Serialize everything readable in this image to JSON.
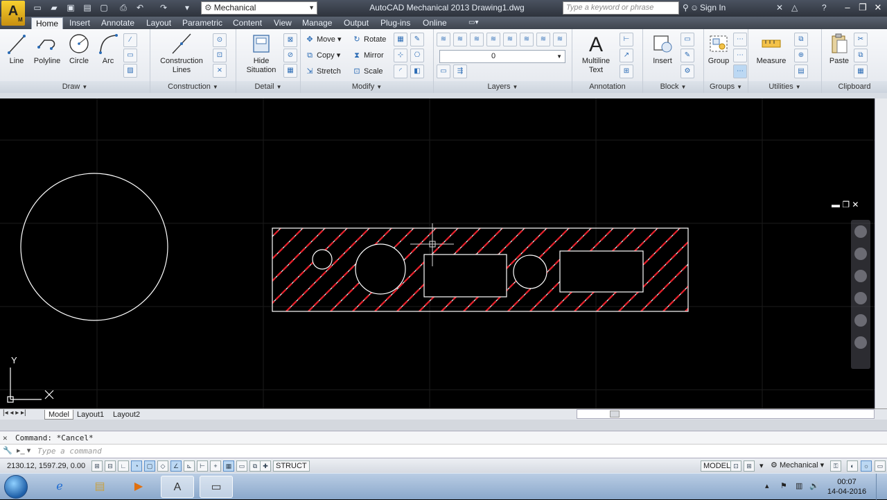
{
  "titlebar": {
    "workspace": "Mechanical",
    "title": "AutoCAD Mechanical 2013    Drawing1.dwg",
    "search_placeholder": "Type a keyword or phrase",
    "sign_in": "Sign In"
  },
  "app_button": {
    "letter": "A",
    "sub": "M"
  },
  "tabs": [
    "Home",
    "Insert",
    "Annotate",
    "Layout",
    "Parametric",
    "Content",
    "View",
    "Manage",
    "Output",
    "Plug-ins",
    "Online"
  ],
  "ribbon": {
    "draw": {
      "title": "Draw",
      "line": "Line",
      "polyline": "Polyline",
      "circle": "Circle",
      "arc": "Arc"
    },
    "construction": {
      "title": "Construction",
      "lines": "Construction\nLines"
    },
    "detail": {
      "title": "Detail",
      "hide": "Hide\nSituation"
    },
    "modify": {
      "title": "Modify",
      "move": "Move",
      "rotate": "Rotate",
      "copy": "Copy",
      "mirror": "Mirror",
      "stretch": "Stretch",
      "scale": "Scale"
    },
    "layers": {
      "title": "Layers",
      "current_layer": "0"
    },
    "annotation": {
      "title": "Annotation",
      "mtext": "Multiline\nText"
    },
    "block": {
      "title": "Block",
      "insert": "Insert"
    },
    "groups": {
      "title": "Groups",
      "group": "Group"
    },
    "utilities": {
      "title": "Utilities",
      "measure": "Measure"
    },
    "clipboard": {
      "title": "Clipboard",
      "paste": "Paste"
    }
  },
  "layout_tabs": [
    "Model",
    "Layout1",
    "Layout2"
  ],
  "command": {
    "history": "Command: *Cancel*",
    "placeholder": "Type a command"
  },
  "status": {
    "coords": "2130.12, 1597.29, 0.00",
    "struct": "STRUCT",
    "model": "MODEL",
    "workspace": "Mechanical"
  },
  "ucs": {
    "x": "X",
    "y": "Y"
  },
  "clock": {
    "time": "00:07",
    "date": "14-04-2016"
  },
  "colors": {
    "hatch": "#e0202a",
    "geometry": "#ffffff",
    "background": "#000000"
  }
}
